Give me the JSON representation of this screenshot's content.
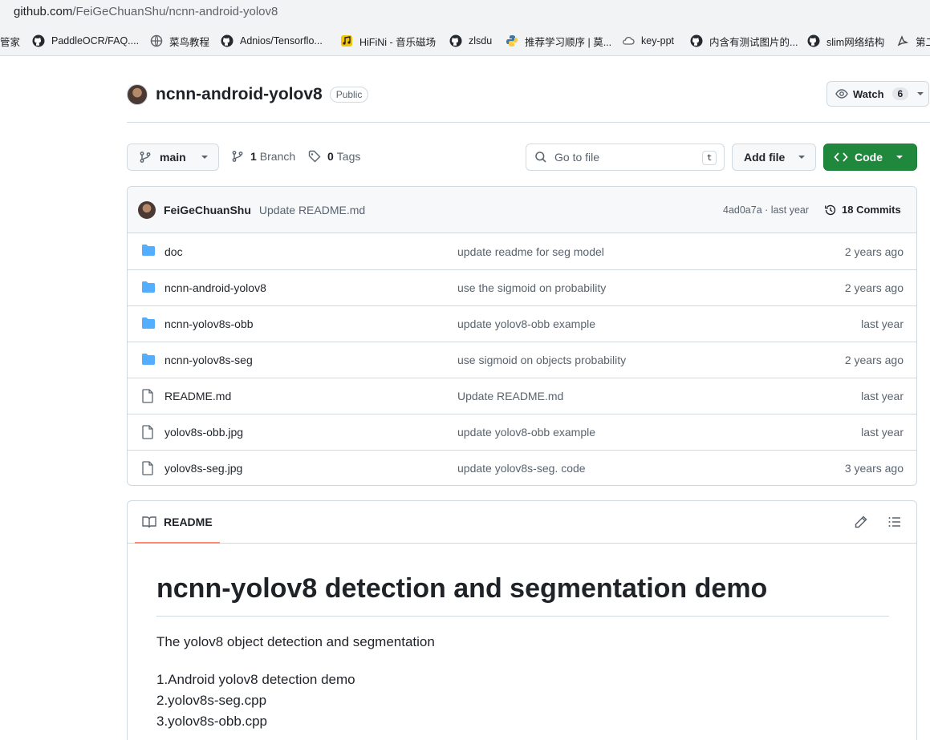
{
  "browser": {
    "url_host": "github.com",
    "url_path": "/FeiGeChuanShu/ncnn-android-yolov8",
    "bookmarks": [
      {
        "label": "管家",
        "icon": "none"
      },
      {
        "label": "PaddleOCR/FAQ....",
        "icon": "github-icon"
      },
      {
        "label": "菜鸟教程",
        "icon": "globe-icon"
      },
      {
        "label": "Adnios/Tensorflo...",
        "icon": "github-icon"
      },
      {
        "label": "HiFiNi - 音乐磁场",
        "icon": "music-icon"
      },
      {
        "label": "zlsdu",
        "icon": "github-icon"
      },
      {
        "label": "推荐学习顺序 | 莫...",
        "icon": "python-icon"
      },
      {
        "label": "key-ppt",
        "icon": "cloud-icon"
      },
      {
        "label": "内含有测试图片的...",
        "icon": "github-icon"
      },
      {
        "label": "slim网络结构",
        "icon": "github-icon"
      },
      {
        "label": "第二",
        "icon": "bird-icon"
      }
    ]
  },
  "repo": {
    "name": "ncnn-android-yolov8",
    "visibility": "Public",
    "watch_label": "Watch",
    "watch_count": "6"
  },
  "toolbar": {
    "branch": "main",
    "branch_count": "1",
    "branch_label": "Branch",
    "tag_count": "0",
    "tag_label": "Tags",
    "gofile_placeholder": "Go to file",
    "gofile_key": "t",
    "add_file": "Add file",
    "code": "Code"
  },
  "latest_commit": {
    "author": "FeiGeChuanShu",
    "message": "Update README.md",
    "sha_time": "4ad0a7a · last year",
    "commits": "18 Commits"
  },
  "files": [
    {
      "type": "folder",
      "name": "doc",
      "message": "update readme for seg model",
      "age": "2 years ago"
    },
    {
      "type": "folder",
      "name": "ncnn-android-yolov8",
      "message": "use the sigmoid on probability",
      "age": "2 years ago"
    },
    {
      "type": "folder",
      "name": "ncnn-yolov8s-obb",
      "message": "update yolov8-obb example",
      "age": "last year"
    },
    {
      "type": "folder",
      "name": "ncnn-yolov8s-seg",
      "message": "use sigmoid on objects probability",
      "age": "2 years ago"
    },
    {
      "type": "file",
      "name": "README.md",
      "message": "Update README.md",
      "age": "last year"
    },
    {
      "type": "file",
      "name": "yolov8s-obb.jpg",
      "message": "update yolov8-obb example",
      "age": "last year"
    },
    {
      "type": "file",
      "name": "yolov8s-seg.jpg",
      "message": "update yolov8s-seg. code",
      "age": "3 years ago"
    }
  ],
  "readme": {
    "tab": "README",
    "heading": "ncnn-yolov8 detection and segmentation demo",
    "intro": "The yolov8 object detection and segmentation",
    "items": [
      "1.Android yolov8 detection demo",
      "2.yolov8s-seg.cpp",
      "3.yolov8s-obb.cpp"
    ]
  },
  "colors": {
    "accent_green": "#1f883d",
    "folder_blue": "#54aeff",
    "tab_underline": "#fd8c73"
  }
}
